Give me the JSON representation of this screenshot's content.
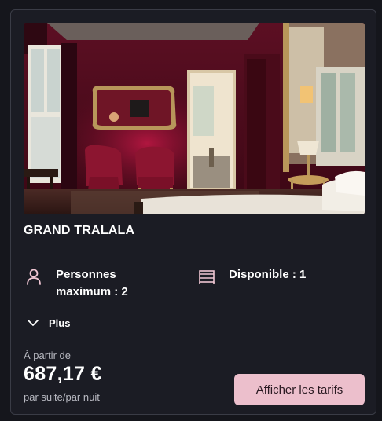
{
  "room": {
    "name": "GRAND TRALALA",
    "image_icon": "room-photo"
  },
  "features": {
    "persons": {
      "icon": "person-icon",
      "label": "Personnes maximum : 2"
    },
    "availability": {
      "icon": "bed-icon",
      "label": "Disponible : 1"
    }
  },
  "more": {
    "icon": "chevron-down-icon",
    "label": "Plus"
  },
  "pricing": {
    "from_label": "À partir de",
    "price": "687,17 €",
    "unit": "par suite/par nuit"
  },
  "actions": {
    "show_rates_label": "Afficher les tarifs"
  },
  "colors": {
    "background": "#15161c",
    "card": "#1b1c24",
    "border": "#3a3c46",
    "accent": "#ecbfcc",
    "icon": "#f0c6d3"
  }
}
